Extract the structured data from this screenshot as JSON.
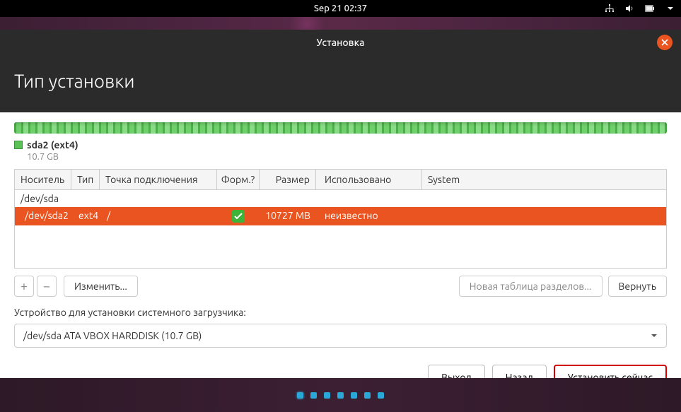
{
  "topbar": {
    "datetime": "Sep 21  02:37"
  },
  "dialog": {
    "title": "Установка"
  },
  "page": {
    "title": "Тип установки"
  },
  "partition_display": {
    "name": "sda2 (ext4)",
    "size": "10.7 GB"
  },
  "table": {
    "headers": {
      "device": "Носитель",
      "type": "Тип",
      "mount": "Точка подключения",
      "format": "Форм.?",
      "size": "Размер",
      "used": "Использовано",
      "system": "System"
    },
    "rows": [
      {
        "device": "/dev/sda",
        "type": "",
        "mount": "",
        "format": false,
        "size": "",
        "used": "",
        "system": "",
        "selected": false,
        "parent": true
      },
      {
        "device": "/dev/sda2",
        "type": "ext4",
        "mount": "/",
        "format": true,
        "size": "10727 MB",
        "used": "неизвестно",
        "system": "",
        "selected": true,
        "parent": false
      }
    ]
  },
  "actions": {
    "add": "+",
    "remove": "−",
    "change": "Изменить...",
    "new_table": "Новая таблица разделов...",
    "revert": "Вернуть"
  },
  "bootloader": {
    "label": "Устройство для установки системного загрузчика:",
    "selected": "/dev/sda   ATA VBOX HARDDISK (10.7 GB)"
  },
  "footer": {
    "quit": "Выход",
    "back": "Назад",
    "install": "Установить сейчас"
  }
}
